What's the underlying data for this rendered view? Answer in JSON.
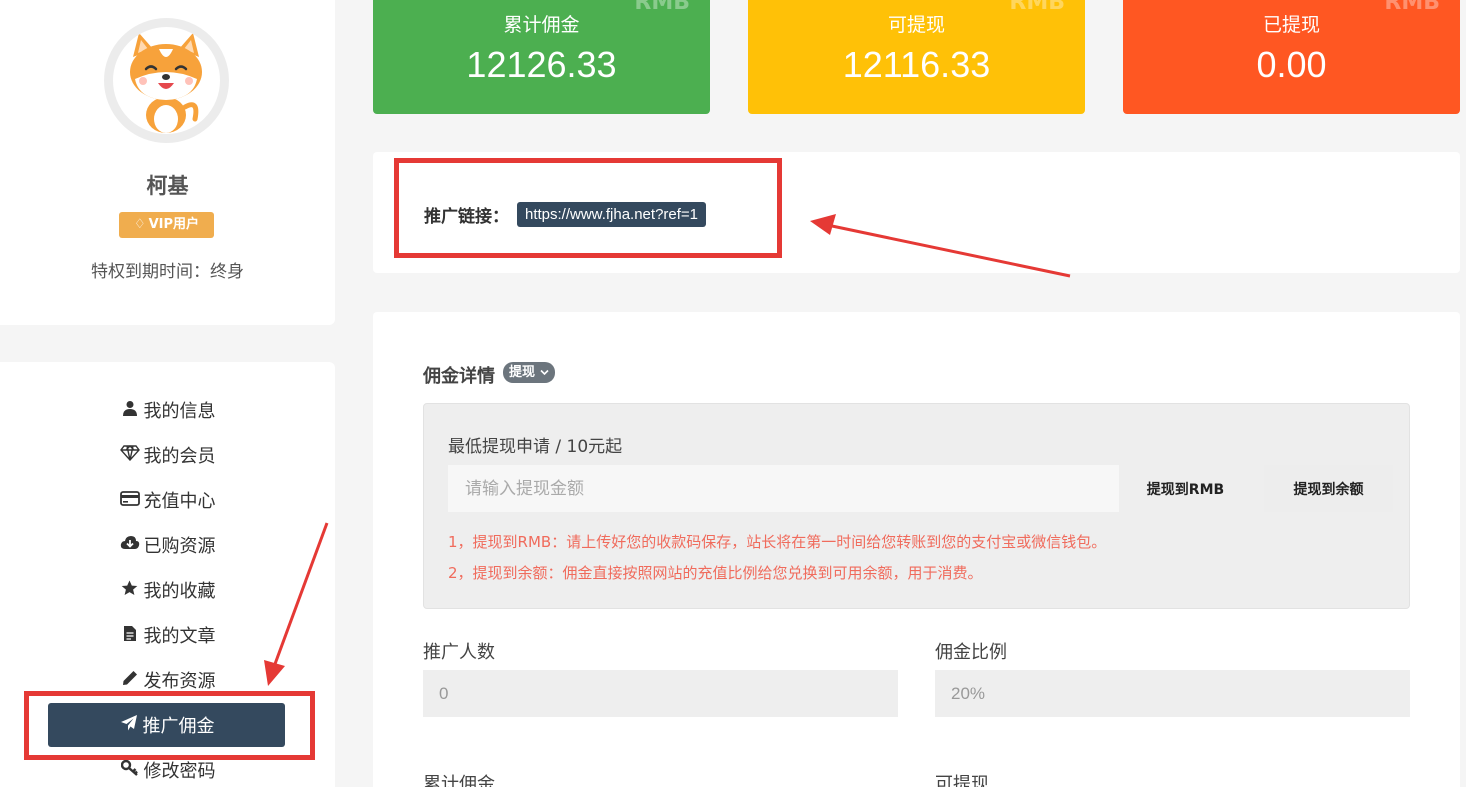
{
  "profile": {
    "name": "柯基",
    "vip_label": "VIP用户",
    "expire_text": "特权到期时间：终身"
  },
  "menu": {
    "items": [
      {
        "label": "我的信息",
        "icon": "user-icon"
      },
      {
        "label": "我的会员",
        "icon": "diamond-icon"
      },
      {
        "label": "充值中心",
        "icon": "credit-card-icon"
      },
      {
        "label": "已购资源",
        "icon": "cloud-download-icon"
      },
      {
        "label": "我的收藏",
        "icon": "star-icon"
      },
      {
        "label": "我的文章",
        "icon": "document-icon"
      },
      {
        "label": "发布资源",
        "icon": "pencil-icon"
      },
      {
        "label": "推广佣金",
        "icon": "paper-plane-icon",
        "active": true
      },
      {
        "label": "修改密码",
        "icon": "key-icon"
      }
    ]
  },
  "stats": [
    {
      "label": "累计佣金",
      "value": "12126.33",
      "unit": "RMB",
      "color": "#4caf50"
    },
    {
      "label": "可提现",
      "value": "12116.33",
      "unit": "RMB",
      "color": "#ffc107"
    },
    {
      "label": "已提现",
      "value": "0.00",
      "unit": "RMB",
      "color": "#ff5722"
    }
  ],
  "promo": {
    "label": "推广链接：",
    "url": "https://www.fjha.net?ref=1"
  },
  "commission": {
    "title": "佣金详情",
    "tag": "提现",
    "withdraw_title": "最低提现申请 / 10元起",
    "amount_placeholder": "请输入提现金额",
    "btn_rmb": "提现到RMB",
    "btn_balance": "提现到余额",
    "note_1": "1，提现到RMB：请上传好您的收款码保存，站长将在第一时间给您转账到您的支付宝或微信钱包。",
    "note_2": "2，提现到余额：佣金直接按照网站的充值比例给您兑换到可用余额，用于消费。",
    "referrals_label": "推广人数",
    "referrals_value": "0",
    "rate_label": "佣金比例",
    "rate_value": "20%",
    "total_label": "累计佣金",
    "available_label": "可提现"
  },
  "colors": {
    "accent_dark": "#34495e",
    "annotation_red": "#e53935",
    "note_red": "#f06b5c",
    "vip_orange": "#f0ad4e"
  }
}
